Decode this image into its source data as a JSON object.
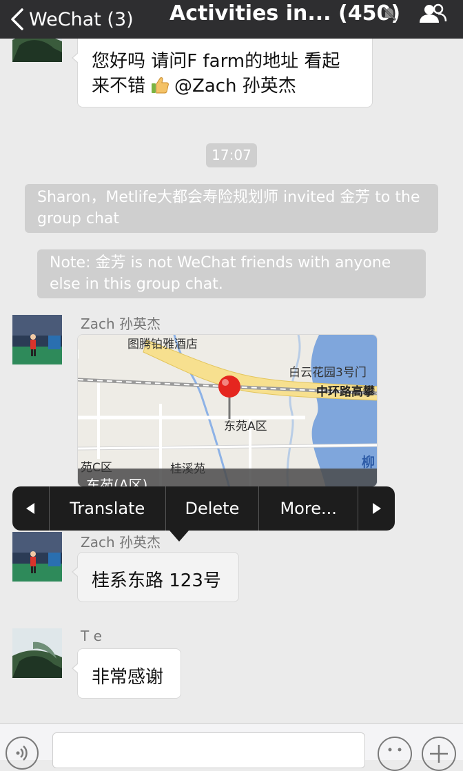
{
  "nav": {
    "back_label": "WeChat (3)",
    "title": "Activities in... (450)"
  },
  "messages": {
    "m1_text_line1": "您好吗 请问F farm的地址 看起",
    "m1_text_line2_before": "来不错",
    "m1_text_line2_after": "@Zach 孙英杰",
    "timestamp": "17:07",
    "sys_invite": "Sharon，Metlife大都会寿险规划师 invited 金芳 to the group chat",
    "sys_note": "Note: 金芳 is not WeChat friends with anyone else in this group chat.",
    "m2_sender": "Zach 孙英杰",
    "m3_sender": "Zach 孙英杰",
    "m3_text": "桂系东路 123号",
    "m4_sender": "T e",
    "m4_text": "非常感谢"
  },
  "map": {
    "label_hotel": "图腾铂雅酒店",
    "label_gate": "白云花园3号门",
    "label_road": "中环路高攀",
    "label_pin": "东苑A区",
    "label_c": "苑C区",
    "label_xi": "桂溪苑",
    "label_liu": "柳",
    "caption": "东苑(A区)"
  },
  "context_menu": {
    "prev_icon": "triangle-left-icon",
    "items": [
      "Translate",
      "Delete",
      "More..."
    ],
    "next_icon": "triangle-right-icon"
  },
  "colors": {
    "navbar": "#2e2e30",
    "chat_bg": "#ebebeb",
    "system_pill": "#cfcfcf",
    "map_pin": "#e5261f",
    "map_water": "#7fa6dc",
    "map_road_yellow": "#f7e08f"
  }
}
